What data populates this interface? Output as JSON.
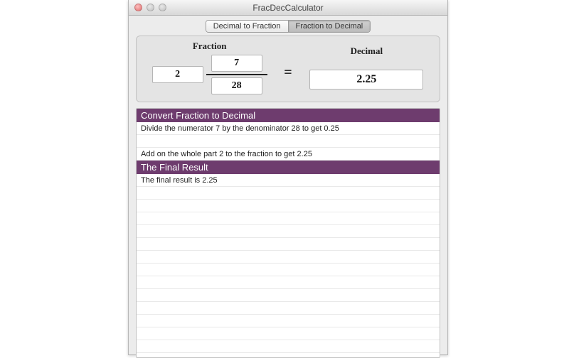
{
  "window": {
    "title": "FracDecCalculator"
  },
  "tabs": {
    "items": [
      {
        "label": "Decimal to Fraction"
      },
      {
        "label": "Fraction to Decimal"
      }
    ],
    "active_index": 1
  },
  "io": {
    "fraction_label": "Fraction",
    "decimal_label": "Decimal",
    "whole": "2",
    "numerator": "7",
    "denominator": "28",
    "equals": "=",
    "decimal": "2.25"
  },
  "steps": {
    "sections": [
      {
        "title": "Convert Fraction to Decimal",
        "lines": [
          "Divide the numerator 7 by the denominator 28 to get 0.25",
          "",
          "Add on the whole part 2 to the fraction to get 2.25"
        ]
      },
      {
        "title": "The Final Result",
        "lines": [
          "The final result is 2.25"
        ]
      }
    ]
  }
}
